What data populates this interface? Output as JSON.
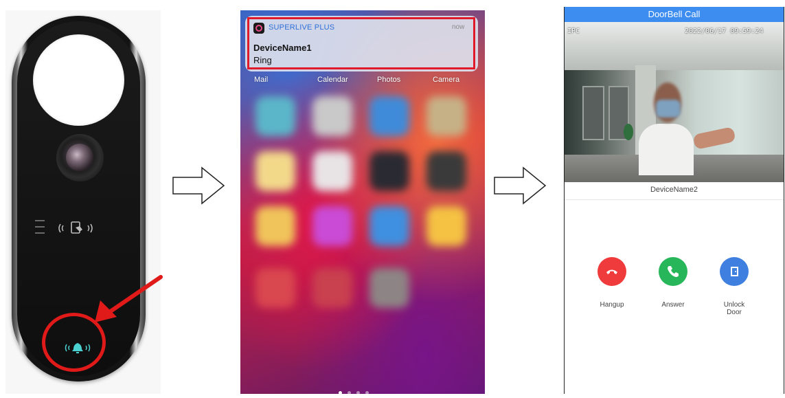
{
  "notification": {
    "app_name": "SUPERLIVE PLUS",
    "time": "now",
    "title": "DeviceName1",
    "body": "Ring"
  },
  "home_screen": {
    "dock_labels": [
      "Mail",
      "Calendar",
      "Photos",
      "Camera"
    ],
    "page_dots": 4,
    "active_page": 1
  },
  "call_screen": {
    "header": "DoorBell Call",
    "video_label_left": "IPC",
    "video_timestamp": "2022/06/17 09:59:24",
    "device_name": "DeviceName2",
    "actions": [
      {
        "label": "Hangup",
        "color": "#ef3b3b",
        "icon": "phone-hangup-icon"
      },
      {
        "label": "Answer",
        "color": "#28b65b",
        "icon": "phone-answer-icon"
      },
      {
        "label": "Unlock\nDoor",
        "color": "#3f7fe0",
        "icon": "door-icon"
      }
    ]
  },
  "colors": {
    "highlight": "#e0192b",
    "header": "#3d8cf0"
  }
}
